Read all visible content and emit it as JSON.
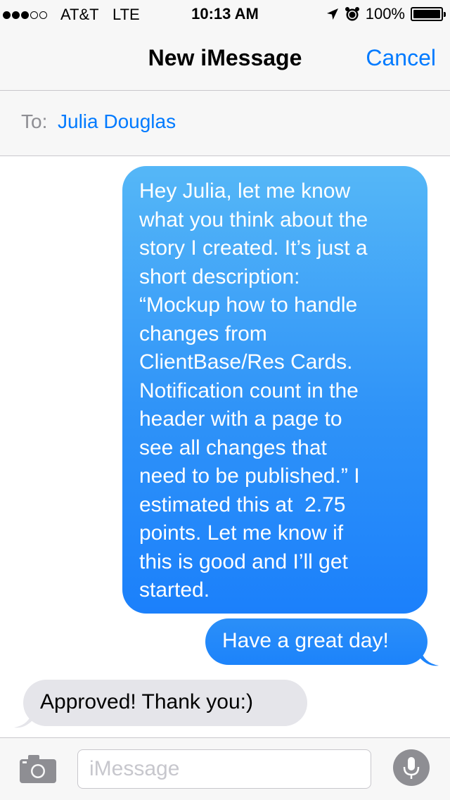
{
  "status_bar": {
    "signal_bars_filled": 3,
    "signal_bars_total": 5,
    "carrier": "AT&T",
    "network": "LTE",
    "time": "10:13 AM",
    "battery_percent": "100%",
    "battery_level": 1.0,
    "icons": [
      "location-arrow-icon",
      "alarm-clock-icon",
      "battery-icon"
    ]
  },
  "nav": {
    "title": "New iMessage",
    "cancel_label": "Cancel"
  },
  "to_field": {
    "label": "To:",
    "recipient": "Julia Douglas"
  },
  "messages": [
    {
      "direction": "outgoing",
      "text": "Hey Julia, let me know what you think about the story I created. It’s just a short description: “Mockup how to handle changes from ClientBase/Res Cards. Notification count in the header with a page to see all changes that need to be published.” I estimated this at  2.75 points. Let me know if this is good and I’ll get started.",
      "lines": [
        "Hey Julia, let me know",
        "what you think about the",
        "story I created. It’s just a",
        "short description:",
        "“Mockup how to handle",
        "changes from",
        "ClientBase/Res Cards.",
        "Notification count in the",
        "header with a page to",
        "see all changes that",
        "need to be published.” I",
        "estimated this at  2.75",
        "points. Let me know if",
        "this is good and I’ll get",
        "started."
      ]
    },
    {
      "direction": "outgoing",
      "text": "Have a great day!"
    },
    {
      "direction": "incoming",
      "text": "Approved! Thank you:)"
    }
  ],
  "input_bar": {
    "placeholder": "iMessage",
    "value": "",
    "camera_icon": "camera-icon",
    "mic_icon": "microphone-icon"
  },
  "colors": {
    "accent": "#007aff",
    "outgoing_bubble": "#1b80fb",
    "incoming_bubble": "#e5e5ea",
    "bar_background": "#f7f7f7"
  }
}
